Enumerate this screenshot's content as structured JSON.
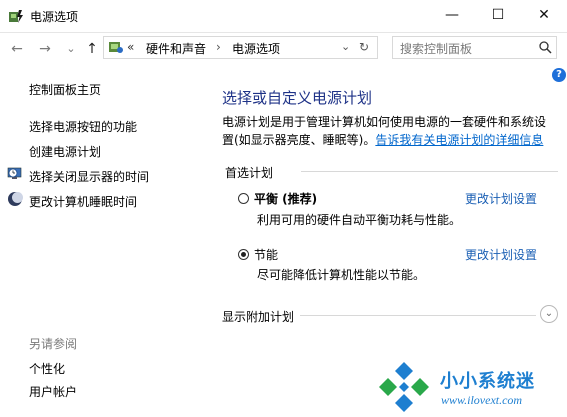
{
  "window": {
    "title": "电源选项"
  },
  "titlebar_buttons": {
    "minimize": "—",
    "maximize": "☐",
    "close": "✕"
  },
  "nav": {
    "back": "←",
    "forward": "→",
    "recent": "⌄",
    "up": "↑",
    "refresh": "↻",
    "dropdown": "⌄"
  },
  "address": {
    "overflow": "«",
    "crumbs": [
      "硬件和声音",
      "电源选项"
    ],
    "sep": "›"
  },
  "search": {
    "placeholder": "搜索控制面板"
  },
  "help": {
    "label": "?"
  },
  "sidebar": {
    "home": "控制面板主页",
    "links": [
      {
        "label": "选择电源按钮的功能",
        "icon": ""
      },
      {
        "label": "创建电源计划",
        "icon": ""
      },
      {
        "label": "选择关闭显示器的时间",
        "icon": "monitor-clock-icon"
      },
      {
        "label": "更改计算机睡眠时间",
        "icon": "moon-icon"
      }
    ],
    "see_also_title": "另请参阅",
    "see_also": [
      "个性化",
      "用户帐户"
    ]
  },
  "main": {
    "heading": "选择或自定义电源计划",
    "desc_text": "电源计划是用于管理计算机如何使用电源的一套硬件和系统设置(如显示器亮度、睡眠等)。",
    "desc_link": "告诉我有关电源计划的详细信息",
    "preferred_title": "首选计划",
    "plans": [
      {
        "name": "平衡 (推荐)",
        "desc": "利用可用的硬件自动平衡功耗与性能。",
        "link": "更改计划设置",
        "selected": false
      },
      {
        "name": "节能",
        "desc": "尽可能降低计算机性能以节能。",
        "link": "更改计划设置",
        "selected": true
      }
    ],
    "more_plans": "显示附加计划"
  },
  "watermark": {
    "text": "小小系统迷",
    "url": "www.ilovext.com"
  },
  "colors": {
    "heading": "#1e3287",
    "link": "#0066cc",
    "accent": "#1e7fd0"
  }
}
